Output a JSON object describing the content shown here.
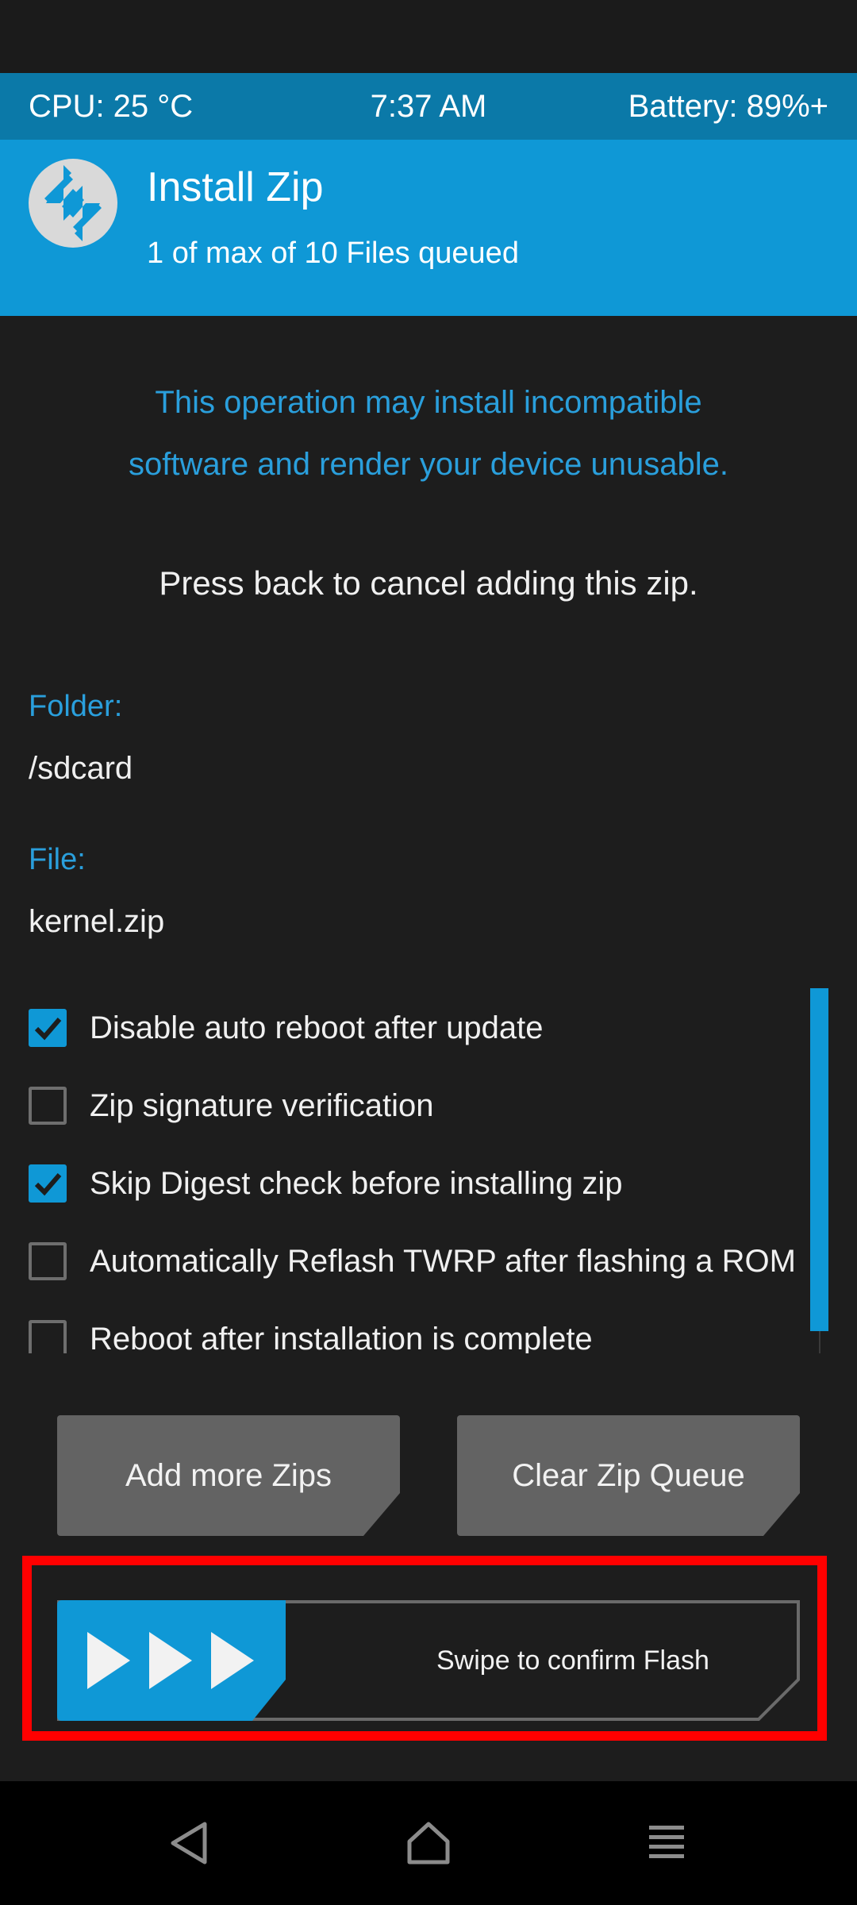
{
  "status_bar": {
    "cpu": "CPU: 25 °C",
    "time": "7:37 AM",
    "battery": "Battery: 89%+"
  },
  "header": {
    "title": "Install Zip",
    "subtitle": "1 of max of 10 Files queued",
    "logo_icon": "twrp-logo-icon"
  },
  "warning": {
    "line1": "This operation may install incompatible",
    "line2": "software and render your device unusable."
  },
  "cancel_hint": "Press back to cancel adding this zip.",
  "folder": {
    "label": "Folder:",
    "value": "/sdcard"
  },
  "file": {
    "label": "File:",
    "value": "kernel.zip"
  },
  "options": [
    {
      "label": "Disable auto reboot after update",
      "checked": true
    },
    {
      "label": "Zip signature verification",
      "checked": false
    },
    {
      "label": "Skip Digest check before installing zip",
      "checked": true
    },
    {
      "label": "Automatically Reflash TWRP after flashing a ROM",
      "checked": false
    },
    {
      "label": "Reboot after installation is complete",
      "checked": false
    }
  ],
  "buttons": {
    "add_more": "Add more Zips",
    "clear_queue": "Clear Zip Queue"
  },
  "swipe": {
    "label": "Swipe to confirm Flash"
  },
  "nav": {
    "back_icon": "back-triangle-icon",
    "home_icon": "home-icon",
    "menu_icon": "menu-icon"
  },
  "colors": {
    "accent": "#0f98d6",
    "status_bar": "#0b79a8",
    "background": "#1d1d1d",
    "button": "#636363",
    "highlight": "#ff0000"
  }
}
